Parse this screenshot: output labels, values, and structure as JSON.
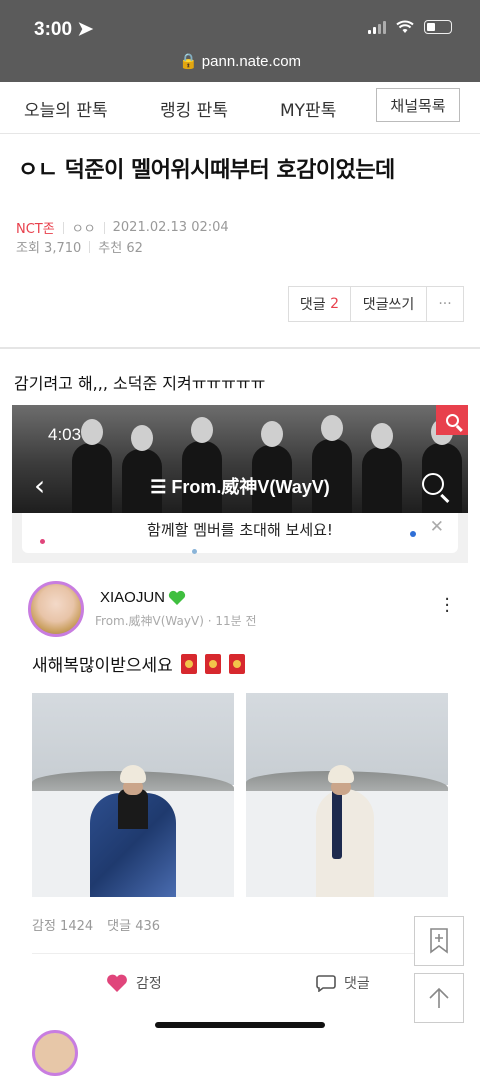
{
  "status": {
    "time": "3:00",
    "url": "pann.nate.com"
  },
  "nav": {
    "tabs": [
      "오늘의 판톡",
      "랭킹 판톡",
      "MY판톡"
    ],
    "channel_button": "채널목록"
  },
  "article": {
    "title": "ㅇㄴ 덕준이 멜어위시때부터 호감이었는데",
    "category": "NCT존",
    "author": "ㅇㅇ",
    "date": "2021.02.13 02:04",
    "views": "조회 3,710",
    "recommends": "추천 62",
    "body": "감기려고 해,,, 소덕준 지켜ㅠㅠㅠㅠㅠ"
  },
  "actions": {
    "comments_label": "댓글",
    "comments_count": "2",
    "write_comment": "댓글쓰기",
    "more": "···"
  },
  "embed": {
    "time": "4:03",
    "title": "☰ From.威神V(WayV)",
    "banner": "함께할 멤버를 초대해 보세요!",
    "close": "✕"
  },
  "post": {
    "author": "XIAOJUN",
    "meta": "From.威神V(WayV) · 11분 전",
    "text": "새해복많이받으세요",
    "emotions": "감정 1424",
    "comments": "댓글 436",
    "react_like": "감정",
    "react_comment": "댓글"
  },
  "colors": {
    "accent_red": "#e8404c",
    "heart_pink": "#e0457b",
    "avatar_ring": "#c87de0"
  }
}
